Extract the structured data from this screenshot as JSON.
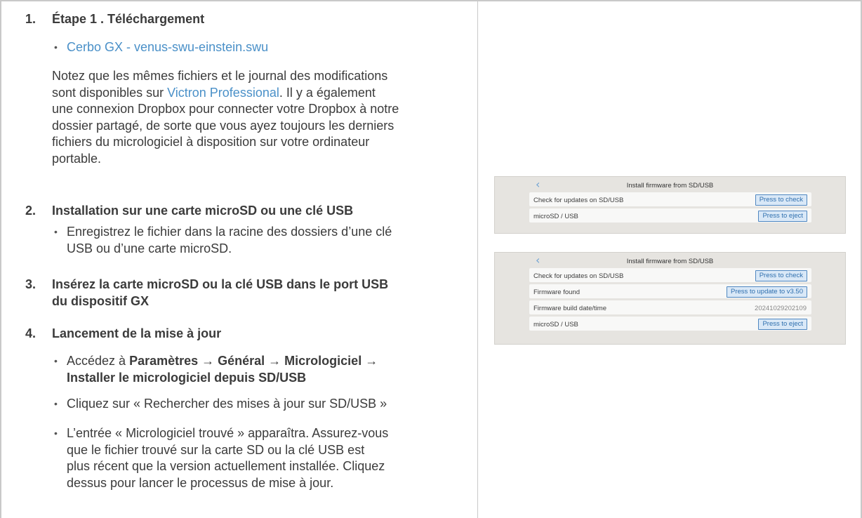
{
  "steps": [
    {
      "num": "1.",
      "title": "Étape 1 . Téléchargement",
      "link": "Cerbo GX - venus-swu-einstein.swu",
      "note": {
        "l1": "Notez que les mêmes fichiers et le journal des modifications",
        "l2_pre": "sont disponibles sur ",
        "l2_link": "Victron Professional",
        "l2_post": ". Il y a également",
        "l3": "une connexion Dropbox pour connecter votre Dropbox à notre",
        "l4": "dossier partagé, de sorte que vous ayez toujours les derniers",
        "l5": "fichiers du micrologiciel à disposition sur votre ordinateur",
        "l6": "portable."
      }
    },
    {
      "num": "2.",
      "title": "Installation sur une carte microSD ou une clé USB",
      "bullet_l1": "Enregistrez le fichier dans la racine des dossiers d’une clé",
      "bullet_l2": "USB ou d’une carte microSD."
    },
    {
      "num": "3.",
      "title_l1": "Insérez la carte microSD ou la clé USB dans le port USB",
      "title_l2": "du dispositif GX"
    },
    {
      "num": "4.",
      "title": "Lancement de la mise à jour",
      "b1_pre": "Accédez à ",
      "b1_bold1": "Paramètres → Général → Micrologiciel →",
      "b1_bold2": "Installer le micrologiciel depuis SD/USB",
      "b2": "Cliquez sur « Rechercher des mises à jour sur SD/USB »",
      "b3_l1": "L’entrée « Micrologiciel trouvé » apparaîtra. Assurez-vous",
      "b3_l2": "que le fichier trouvé sur la carte SD ou la clé USB est",
      "b3_l3": "plus récent que la version actuellement installée. Cliquez",
      "b3_l4": "dessus pour lancer le processus de mise à jour."
    }
  ],
  "screens": {
    "back_icon": "chevron-left-icon",
    "screen1": {
      "title": "Install firmware from SD/USB",
      "rows": [
        {
          "label": "Check for updates on SD/USB",
          "button": "Press to check"
        },
        {
          "label": "microSD / USB",
          "button": "Press to eject"
        }
      ]
    },
    "screen2": {
      "title": "Install firmware from SD/USB",
      "rows": [
        {
          "label": "Check for updates on SD/USB",
          "button": "Press to check"
        },
        {
          "label": "Firmware found",
          "button": "Press to update to v3.50"
        },
        {
          "label": "Firmware build date/time",
          "value": "20241029202109"
        },
        {
          "label": "microSD / USB",
          "button": "Press to eject"
        }
      ]
    }
  },
  "colors": {
    "link": "#4a90c8",
    "button_border": "#4f87c1",
    "panel_bg": "#e6e4e0"
  }
}
